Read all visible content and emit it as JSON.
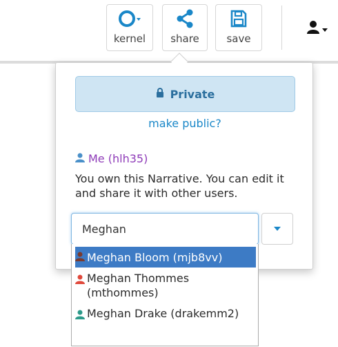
{
  "toolbar": {
    "kernel_label": "kernel",
    "share_label": "share",
    "save_label": "save"
  },
  "share_panel": {
    "private_label": "Private",
    "make_public_link": "make public?",
    "me_label": "Me (hlh35)",
    "owner_message": "You own this Narrative. You can edit it and share it with other users.",
    "search_value": "Meghan"
  },
  "user_suggestions": [
    {
      "text": "Meghan Bloom (mjb8vv)",
      "color": "#7a3a2e"
    },
    {
      "text": "Meghan Thommes (mthommes)",
      "color": "#e0483b"
    },
    {
      "text": "Meghan Drake (drakemm2)",
      "color": "#2d9a8a"
    }
  ],
  "colors": {
    "accent": "#1a87c8",
    "me_purple": "#8e3bb8",
    "private_bg": "#cfe5f3",
    "highlight": "#3d7bc5"
  },
  "icons": {
    "kernel": "kernel-status-icon",
    "share": "share-icon",
    "save": "save-disk-icon",
    "user": "user-icon",
    "lock": "lock-icon"
  }
}
